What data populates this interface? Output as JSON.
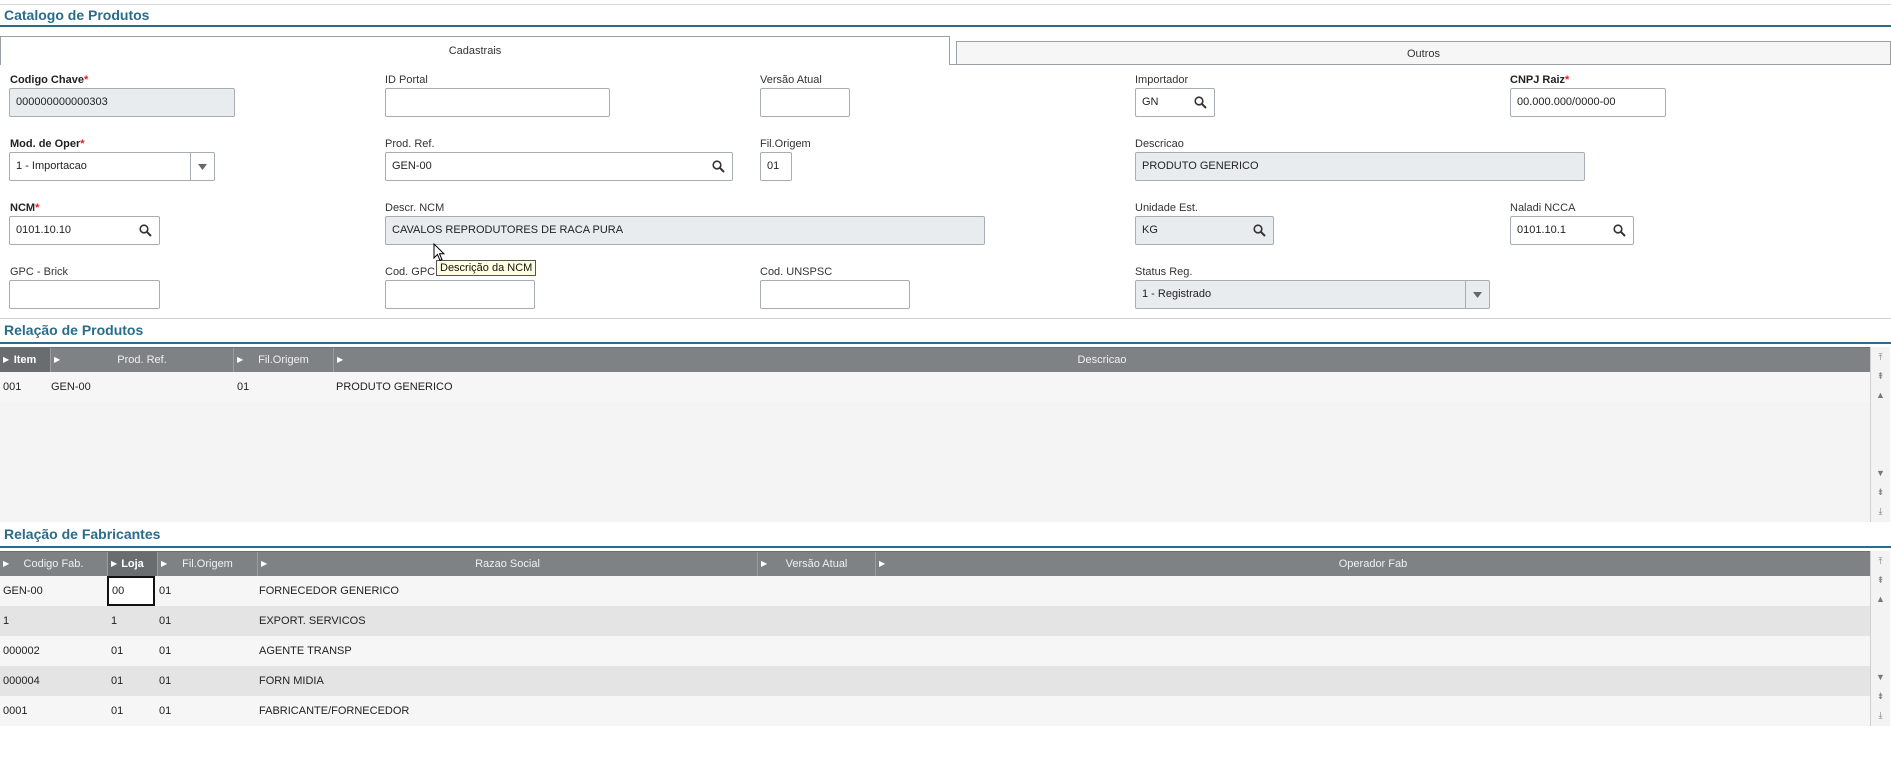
{
  "page": {
    "title": "Catalogo de Produtos",
    "tabs": [
      {
        "label": "Cadastrais",
        "active": true
      },
      {
        "label": "Outros",
        "active": false
      }
    ]
  },
  "form": {
    "codigo_chave": {
      "label": "Codigo Chave",
      "value": "000000000000303"
    },
    "id_portal": {
      "label": "ID Portal",
      "value": ""
    },
    "versao_atual": {
      "label": "Versão Atual",
      "value": ""
    },
    "importador": {
      "label": "Importador",
      "value": "GN"
    },
    "cnpj_raiz": {
      "label": "CNPJ Raiz",
      "value": "00.000.000/0000-00"
    },
    "mod_oper": {
      "label": "Mod. de Oper",
      "value": "1 - Importacao"
    },
    "prod_ref": {
      "label": "Prod. Ref.",
      "value": "GEN-00"
    },
    "fil_origem": {
      "label": "Fil.Origem",
      "value": "01"
    },
    "descricao": {
      "label": "Descricao",
      "value": "PRODUTO GENERICO"
    },
    "ncm": {
      "label": "NCM",
      "value": "0101.10.10"
    },
    "descr_ncm": {
      "label": "Descr. NCM",
      "value": "CAVALOS REPRODUTORES DE RACA PURA"
    },
    "unidade_est": {
      "label": "Unidade Est.",
      "value": "KG"
    },
    "naladi_ncca": {
      "label": "Naladi NCCA",
      "value": "0101.10.1"
    },
    "gpc_brick": {
      "label": "GPC - Brick",
      "value": ""
    },
    "cod_gpc": {
      "label": "Cod. GPC",
      "value": ""
    },
    "cod_unspsc": {
      "label": "Cod. UNSPSC",
      "value": ""
    },
    "status_reg": {
      "label": "Status Reg.",
      "value": "1 - Registrado"
    },
    "required_mark": "*"
  },
  "tooltip": "Descrição da NCM",
  "produtos": {
    "title": "Relação de Produtos",
    "columns": [
      "Item",
      "Prod. Ref.",
      "Fil.Origem",
      "Descricao"
    ],
    "rows": [
      {
        "item": "001",
        "prod_ref": "GEN-00",
        "fil_origem": "01",
        "descricao": "PRODUTO GENERICO"
      }
    ]
  },
  "fabricantes": {
    "title": "Relação de Fabricantes",
    "columns": [
      "Codigo Fab.",
      "Loja",
      "Fil.Origem",
      "Razao Social",
      "Versão Atual",
      "Operador Fab"
    ],
    "rows": [
      {
        "codigo": "GEN-00",
        "loja": "00",
        "fil": "01",
        "razao": "FORNECEDOR GENERICO"
      },
      {
        "codigo": "1",
        "loja": "1",
        "fil": "01",
        "razao": "EXPORT. SERVICOS"
      },
      {
        "codigo": "000002",
        "loja": "01",
        "fil": "01",
        "razao": "AGENTE TRANSP"
      },
      {
        "codigo": "000004",
        "loja": "01",
        "fil": "01",
        "razao": "FORN MIDIA"
      },
      {
        "codigo": "0001",
        "loja": "01",
        "fil": "01",
        "razao": "FABRICANTE/FORNECEDOR"
      }
    ]
  },
  "colors": {
    "accent": "#2a6c8a",
    "required": "#e02020",
    "grid_header": "#7f8285",
    "readonly": "#e9ecef"
  },
  "icons": [
    "search-icon",
    "chevron-down-icon",
    "sort-arrow-icon",
    "scroll-top-icon",
    "scroll-pageup-icon",
    "scroll-up-icon",
    "scroll-down-icon",
    "scroll-pagedown-icon",
    "scroll-bottom-icon",
    "mouse-cursor-icon"
  ]
}
